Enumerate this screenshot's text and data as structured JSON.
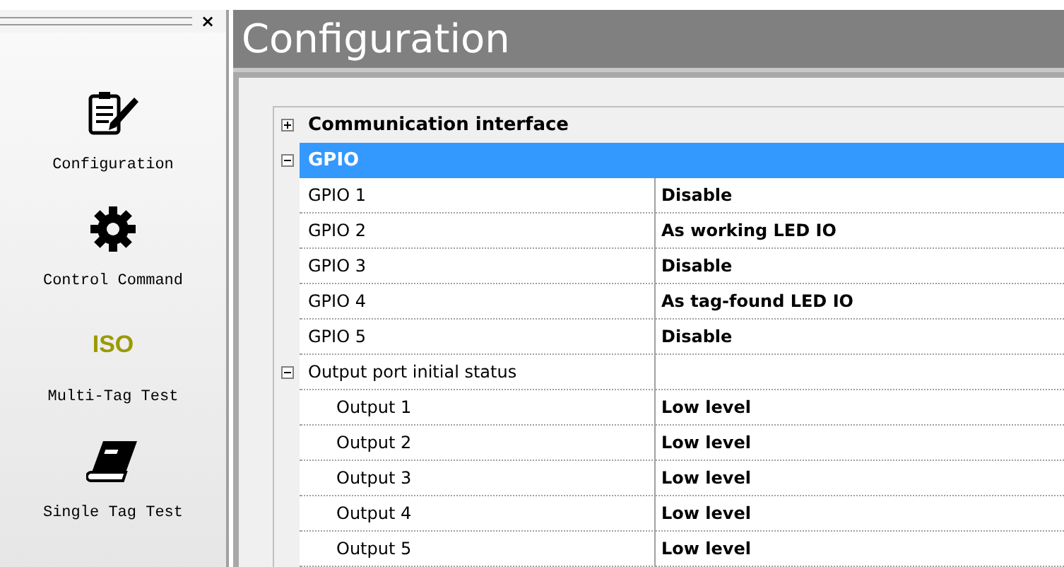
{
  "sidebar": {
    "close": "×",
    "items": [
      {
        "kind": "clipboard",
        "label": "Configuration"
      },
      {
        "kind": "gear",
        "label": "Control Command"
      },
      {
        "kind": "text",
        "glyph": "ISO",
        "label": "Multi-Tag Test"
      },
      {
        "kind": "book",
        "label": "Single Tag Test"
      }
    ]
  },
  "title": "Configuration",
  "grid": [
    {
      "label": "Communication interface",
      "expanded": false,
      "selected": false
    },
    {
      "label": "GPIO",
      "expanded": true,
      "selected": true,
      "children": [
        {
          "kind": "property",
          "name": "GPIO 1",
          "value": "Disable"
        },
        {
          "kind": "property",
          "name": "GPIO 2",
          "value": "As working LED IO"
        },
        {
          "kind": "property",
          "name": "GPIO 3",
          "value": "Disable"
        },
        {
          "kind": "property",
          "name": "GPIO 4",
          "value": "As tag-found LED IO"
        },
        {
          "kind": "property",
          "name": "GPIO 5",
          "value": "Disable"
        },
        {
          "kind": "group",
          "name": "Output port initial status",
          "expanded": true,
          "children": [
            {
              "kind": "property",
              "name": "Output 1",
              "value": "Low level"
            },
            {
              "kind": "property",
              "name": "Output 2",
              "value": "Low level"
            },
            {
              "kind": "property",
              "name": "Output 3",
              "value": "Low level"
            },
            {
              "kind": "property",
              "name": "Output 4",
              "value": "Low level"
            },
            {
              "kind": "property",
              "name": "Output 5",
              "value": "Low level"
            }
          ]
        }
      ]
    }
  ]
}
